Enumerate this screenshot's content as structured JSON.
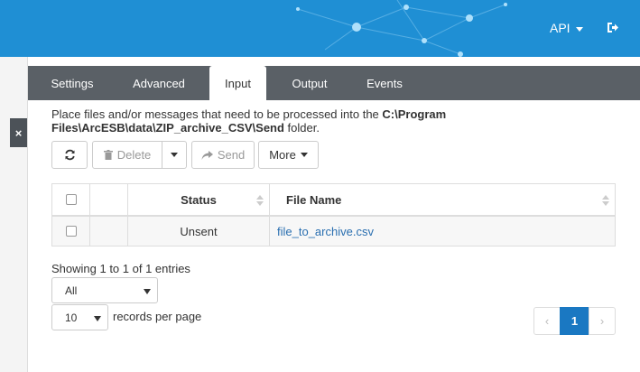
{
  "header": {
    "api_menu_label": "API",
    "logout_icon": "sign-out-icon"
  },
  "sidebar": {
    "close_label": "×"
  },
  "tabs": [
    {
      "label": "Settings"
    },
    {
      "label": "Advanced"
    },
    {
      "label": "Input",
      "active": true
    },
    {
      "label": "Output"
    },
    {
      "label": "Events"
    }
  ],
  "instructions": {
    "prefix": "Place files and/or messages that need to be processed into the ",
    "path_line1": "C:\\Program",
    "path_line2": "Files\\ArcESB\\data\\ZIP_archive_CSV\\Send",
    "suffix": " folder."
  },
  "toolbar": {
    "refresh_icon": "refresh-icon",
    "delete_label": "Delete",
    "send_label": "Send",
    "more_label": "More"
  },
  "table": {
    "columns": [
      "Status",
      "File Name"
    ],
    "rows": [
      {
        "status": "Unsent",
        "file_name": "file_to_archive.csv"
      }
    ]
  },
  "footer": {
    "entries_text": "Showing 1 to 1 of 1 entries",
    "filter_value": "All",
    "page_size_value": "10",
    "records_per_page": "records per page",
    "current_page": "1",
    "prev_label": "‹",
    "next_label": "›"
  },
  "colors": {
    "header_blue": "#1f8fd4",
    "tabbar_gray": "#5a6066",
    "link_blue": "#2a6fb0",
    "pager_active": "#1a78c2"
  }
}
